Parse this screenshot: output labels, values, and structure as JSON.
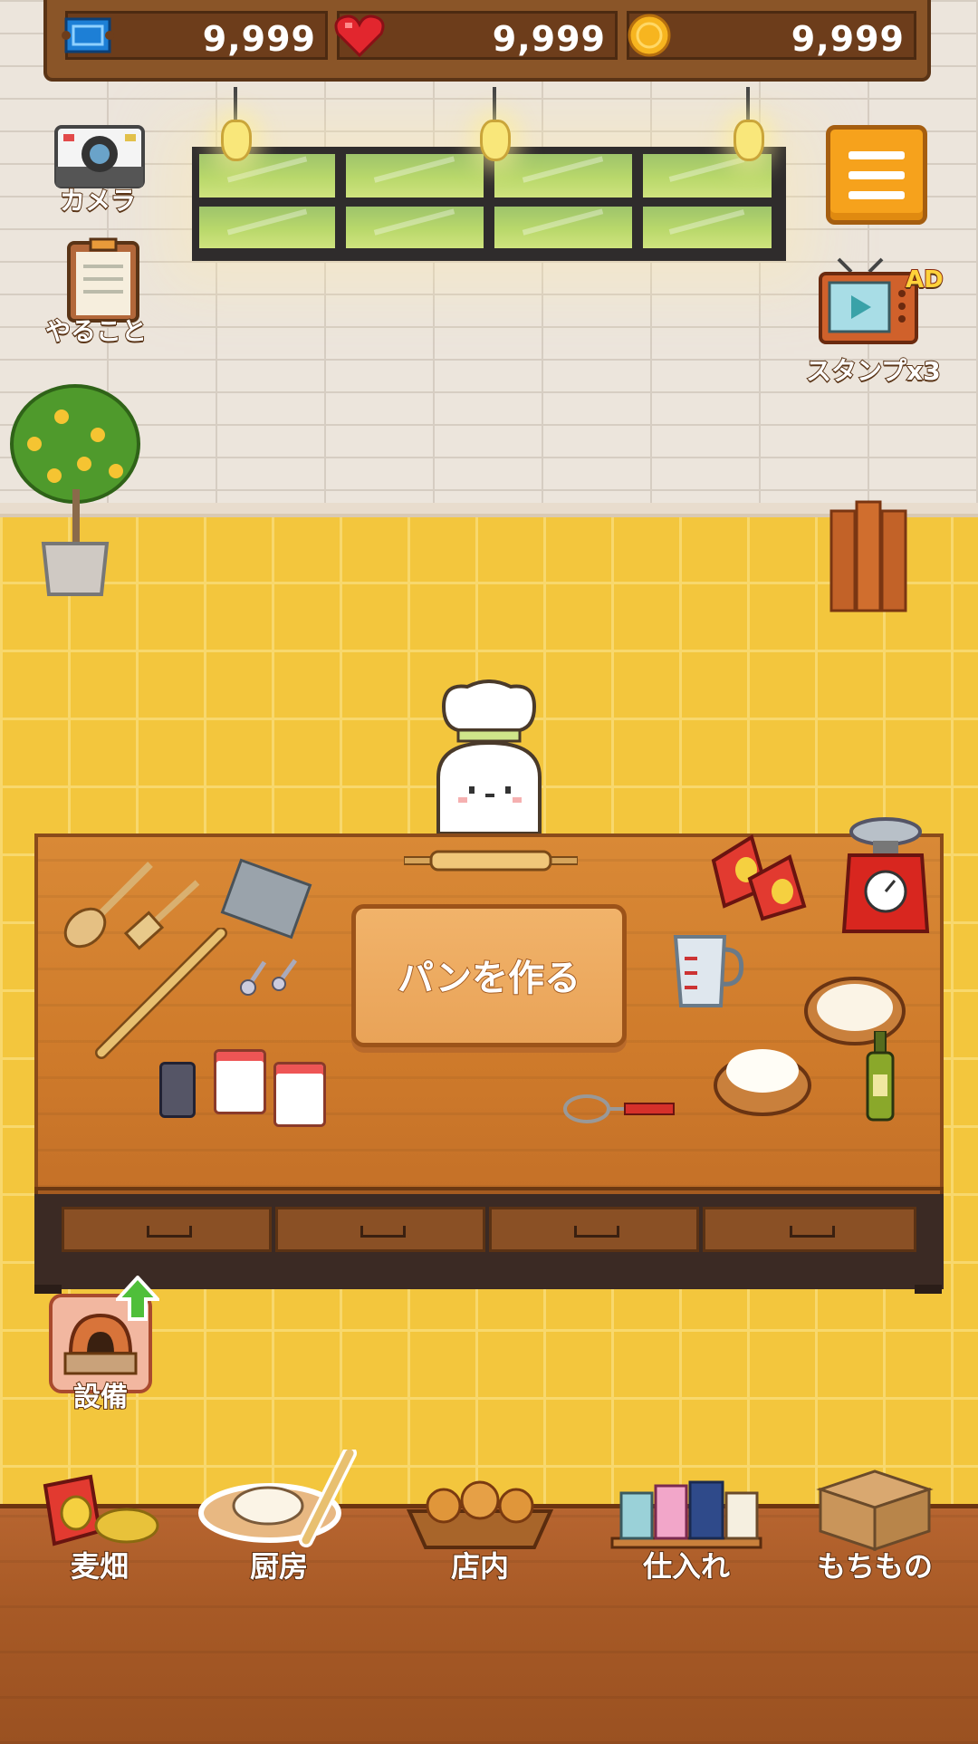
{
  "currency": {
    "tickets": "9,999",
    "hearts": "9,999",
    "coins": "9,999"
  },
  "side_left": {
    "camera_label": "カメラ",
    "todo_label": "やること"
  },
  "side_right": {
    "stamp_label": "スタンプx3",
    "ad_badge": "AD"
  },
  "table": {
    "make_bread_label": "パンを作る"
  },
  "equipment": {
    "label": "設備"
  },
  "nav": {
    "items": [
      {
        "label": "麦畑"
      },
      {
        "label": "厨房"
      },
      {
        "label": "店内"
      },
      {
        "label": "仕入れ"
      },
      {
        "label": "もちもの"
      }
    ]
  },
  "colors": {
    "floor": "#f3c63d",
    "wall": "#ece5dc",
    "accent": "#f6a21c",
    "wood": "#cf7b2b"
  },
  "icons": [
    "ticket-icon",
    "heart-icon",
    "coin-icon",
    "camera-icon",
    "clipboard-icon",
    "menu-icon",
    "tv-icon",
    "oven-icon",
    "up-arrow-icon"
  ]
}
